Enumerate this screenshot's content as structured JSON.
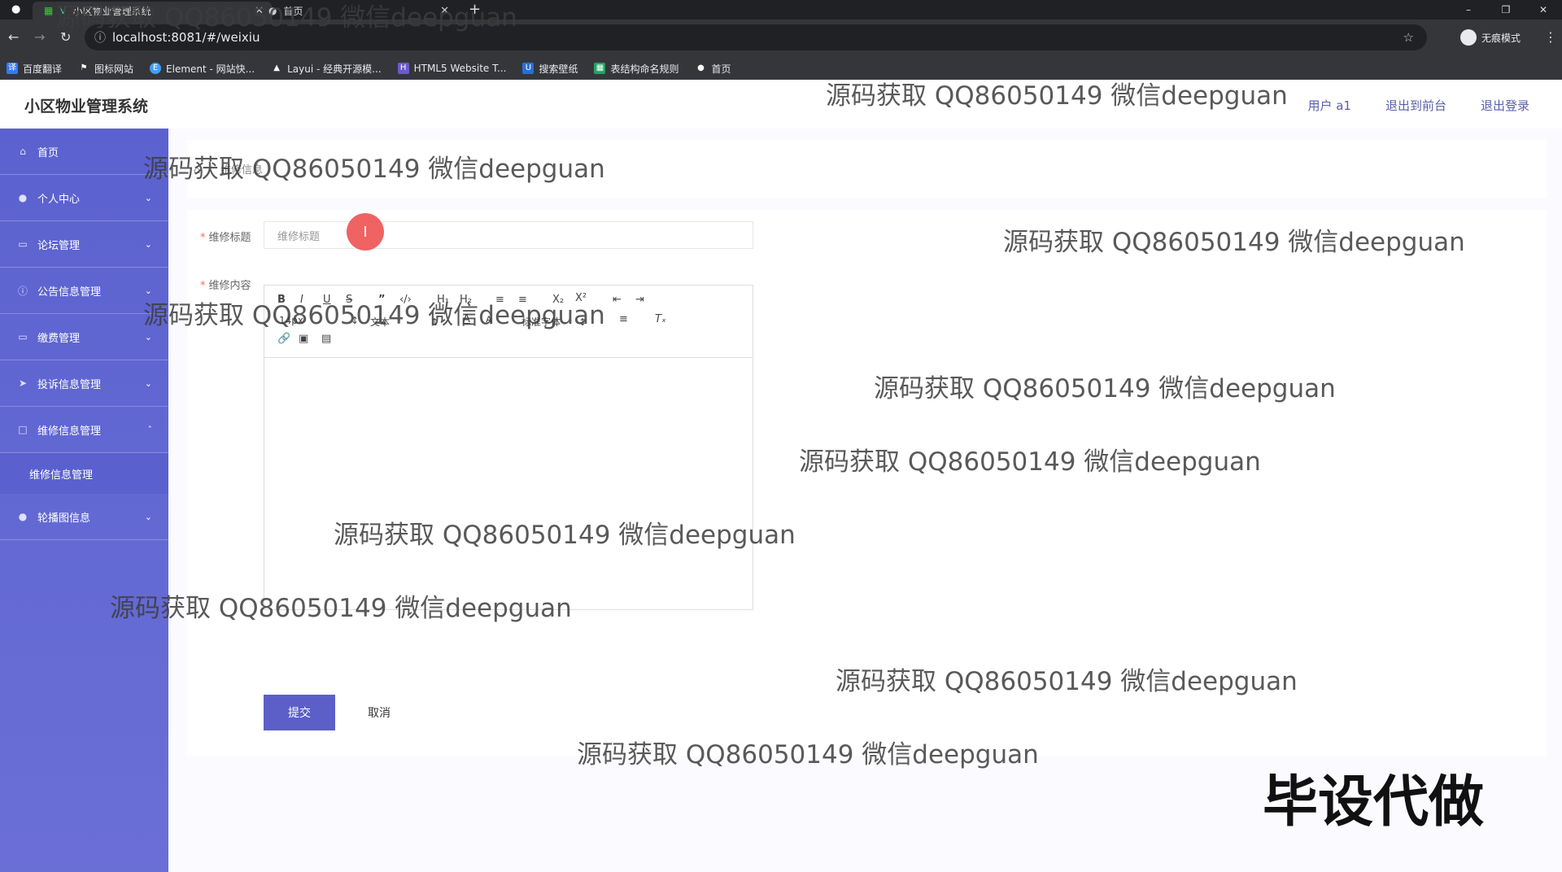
{
  "browser": {
    "tabs": [
      {
        "title": "小区物业管理系统"
      },
      {
        "title": "首页"
      }
    ],
    "new_tab": "+",
    "url": "localhost:8081/#/weixiu",
    "profile_label": "无痕模式",
    "bookmarks": [
      {
        "label": "百度翻译"
      },
      {
        "label": "图标网站"
      },
      {
        "label": "Element - 网站快..."
      },
      {
        "label": "Layui - 经典开源模..."
      },
      {
        "label": "HTML5 Website T..."
      },
      {
        "label": "搜索壁纸"
      },
      {
        "label": "表结构命名规则"
      },
      {
        "label": "首页"
      }
    ]
  },
  "header": {
    "title": "小区物业管理系统",
    "user": "用户 a1",
    "back_front": "退出到前台",
    "logout": "退出登录"
  },
  "sidebar": {
    "items": [
      {
        "label": "首页",
        "icon": "home-icon"
      },
      {
        "label": "个人中心",
        "icon": "user-icon"
      },
      {
        "label": "论坛管理",
        "icon": "forum-icon"
      },
      {
        "label": "公告信息管理",
        "icon": "notice-icon"
      },
      {
        "label": "缴费管理",
        "icon": "payment-icon"
      },
      {
        "label": "投诉信息管理",
        "icon": "complaint-icon"
      },
      {
        "label": "维修信息管理",
        "icon": "repair-icon"
      },
      {
        "label": "轮播图信息",
        "icon": "carousel-icon"
      }
    ],
    "submenu_label": "维修信息管理"
  },
  "breadcrumb": {
    "current": "维修信息"
  },
  "form": {
    "title_label": "维修标题",
    "title_placeholder": "维修标题",
    "content_label": "维修内容",
    "toolbar": {
      "size": "14px",
      "block": "文本",
      "font": "标准字体"
    },
    "submit": "提交",
    "cancel": "取消"
  },
  "overlay": {
    "watermark": "源码获取 QQ86050149 微信deepguan",
    "corner_text": "毕设代做"
  },
  "colors": {
    "sidebar": "#5b62cf",
    "accent": "#5b5fc7",
    "required": "#f56c6c"
  }
}
